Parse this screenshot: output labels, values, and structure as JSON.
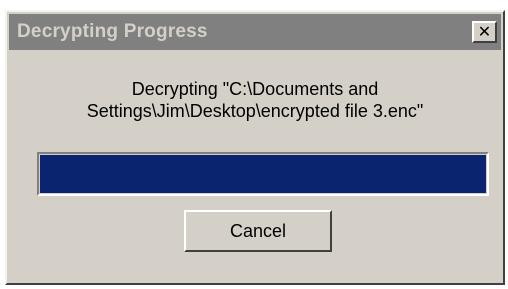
{
  "window": {
    "title": "Decrypting Progress",
    "close_glyph": "✕",
    "close_icon": "close-icon"
  },
  "message": {
    "line1": "Decrypting \"C:\\Documents and",
    "line2": "Settings\\Jim\\Desktop\\encrypted file 3.enc\""
  },
  "progress": {
    "fraction": 1.0
  },
  "buttons": {
    "cancel_label": "Cancel"
  },
  "colors": {
    "titlebar_inactive": "#808080",
    "title_text": "#d4d0c8",
    "face": "#d4d0c8",
    "progress_fill": "#0a2470"
  }
}
